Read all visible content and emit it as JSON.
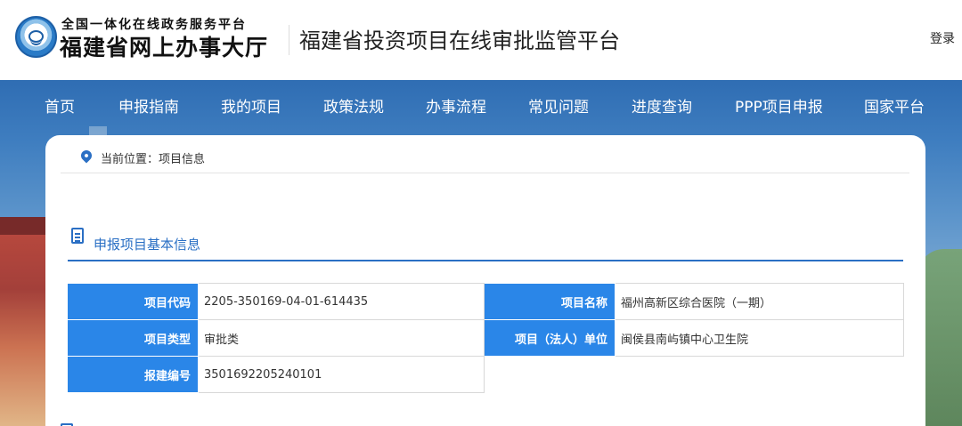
{
  "header": {
    "logo_small": "全国一体化在线政务服务平台",
    "logo_big": "福建省网上办事大厅",
    "platform_title": "福建省投资项目在线审批监管平台",
    "login_label": "登录"
  },
  "nav": {
    "items": [
      "首页",
      "申报指南",
      "我的项目",
      "政策法规",
      "办事流程",
      "常见问题",
      "进度查询",
      "PPP项目申报",
      "国家平台"
    ]
  },
  "breadcrumb": {
    "text": "当前位置：项目信息"
  },
  "section": {
    "title": "申报项目基本信息"
  },
  "info": {
    "project_code_label": "项目代码",
    "project_code_value": "2205-350169-04-01-614435",
    "project_name_label": "项目名称",
    "project_name_value": "福州高新区综合医院（一期）",
    "project_type_label": "项目类型",
    "project_type_value": "审批类",
    "legal_unit_label": "项目（法人）单位",
    "legal_unit_value": "闽侯县南屿镇中心卫生院",
    "filing_no_label": "报建编号",
    "filing_no_value": "3501692205240101"
  },
  "colors": {
    "nav_bg": "#2f6db3",
    "accent": "#2a6fc4",
    "label_bg": "#2a86e8"
  },
  "icons": [
    "emblem-logo",
    "location-icon",
    "document-icon"
  ]
}
